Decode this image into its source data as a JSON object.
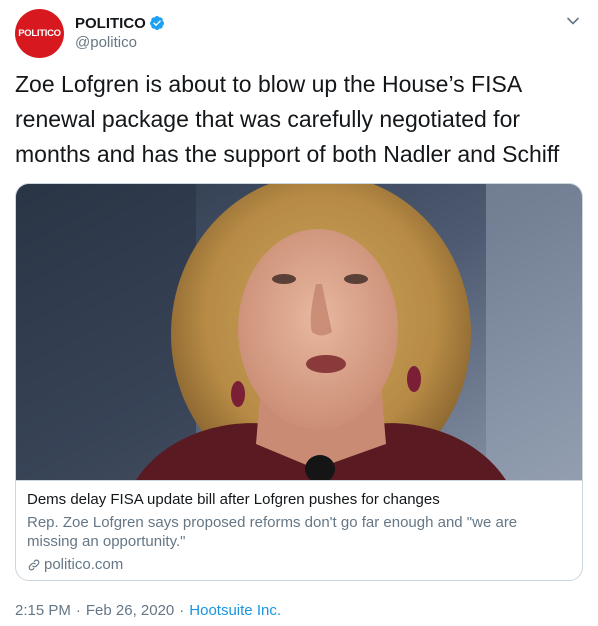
{
  "colors": {
    "brand": "#d7191f",
    "link": "#1b95e0",
    "secondary_text": "#657786",
    "verified": "#1da1f2"
  },
  "author": {
    "avatar_text": "POLITICO",
    "name": "POLITICO",
    "handle": "@politico",
    "verified_icon": "verified-badge-icon"
  },
  "menu": {
    "icon": "chevron-down-icon"
  },
  "tweet": {
    "text": "Zoe Lofgren is about to blow up the House’s FISA renewal package that was carefully negotiated for months and has the support of both Nadler and Schiff"
  },
  "card": {
    "title": "Dems delay FISA update bill after Lofgren pushes for changes",
    "description": "Rep. Zoe Lofgren says proposed reforms don't go far enough and \"we are missing an opportunity.\"",
    "domain": "politico.com",
    "domain_icon": "link-icon"
  },
  "meta": {
    "time": "2:15 PM",
    "separator": "·",
    "date": "Feb 26, 2020",
    "source": "Hootsuite Inc."
  }
}
